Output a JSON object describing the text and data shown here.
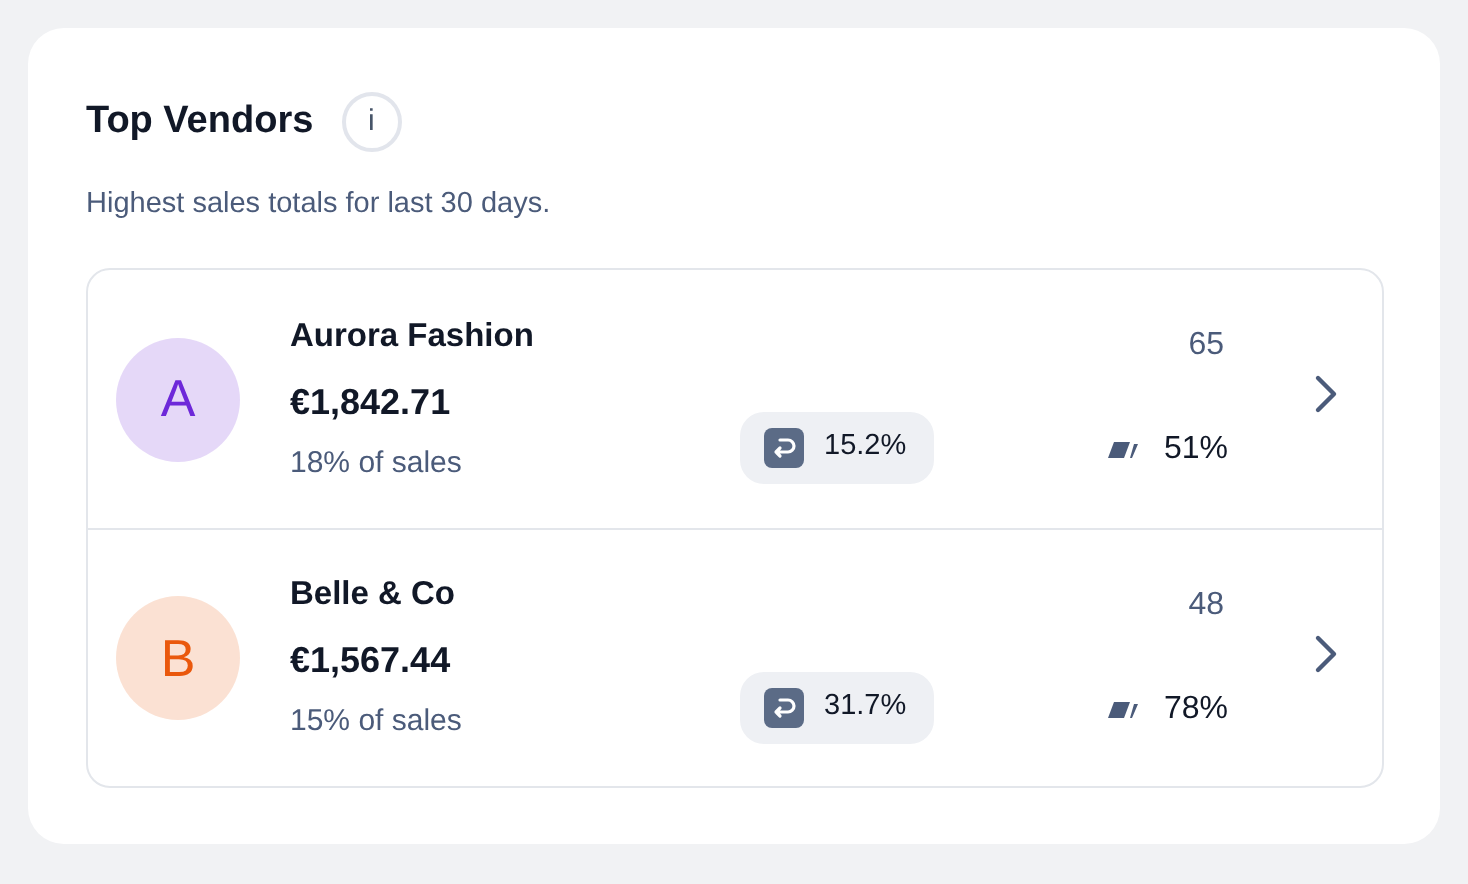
{
  "title": "Top Vendors",
  "info_icon": "i",
  "subtitle": "Highest sales totals for last 30 days.",
  "vendors": [
    {
      "initial": "A",
      "color": "#6d28d9",
      "name": "Aurora Fashion",
      "amount": "€1,842.71",
      "share": "18% of sales",
      "return_rate": "15.2%",
      "count": "65",
      "percent": "51%"
    },
    {
      "initial": "B",
      "color": "#ea580c",
      "name": "Belle & Co",
      "amount": "€1,567.44",
      "share": "15% of sales",
      "return_rate": "31.7%",
      "count": "48",
      "percent": "78%"
    }
  ]
}
